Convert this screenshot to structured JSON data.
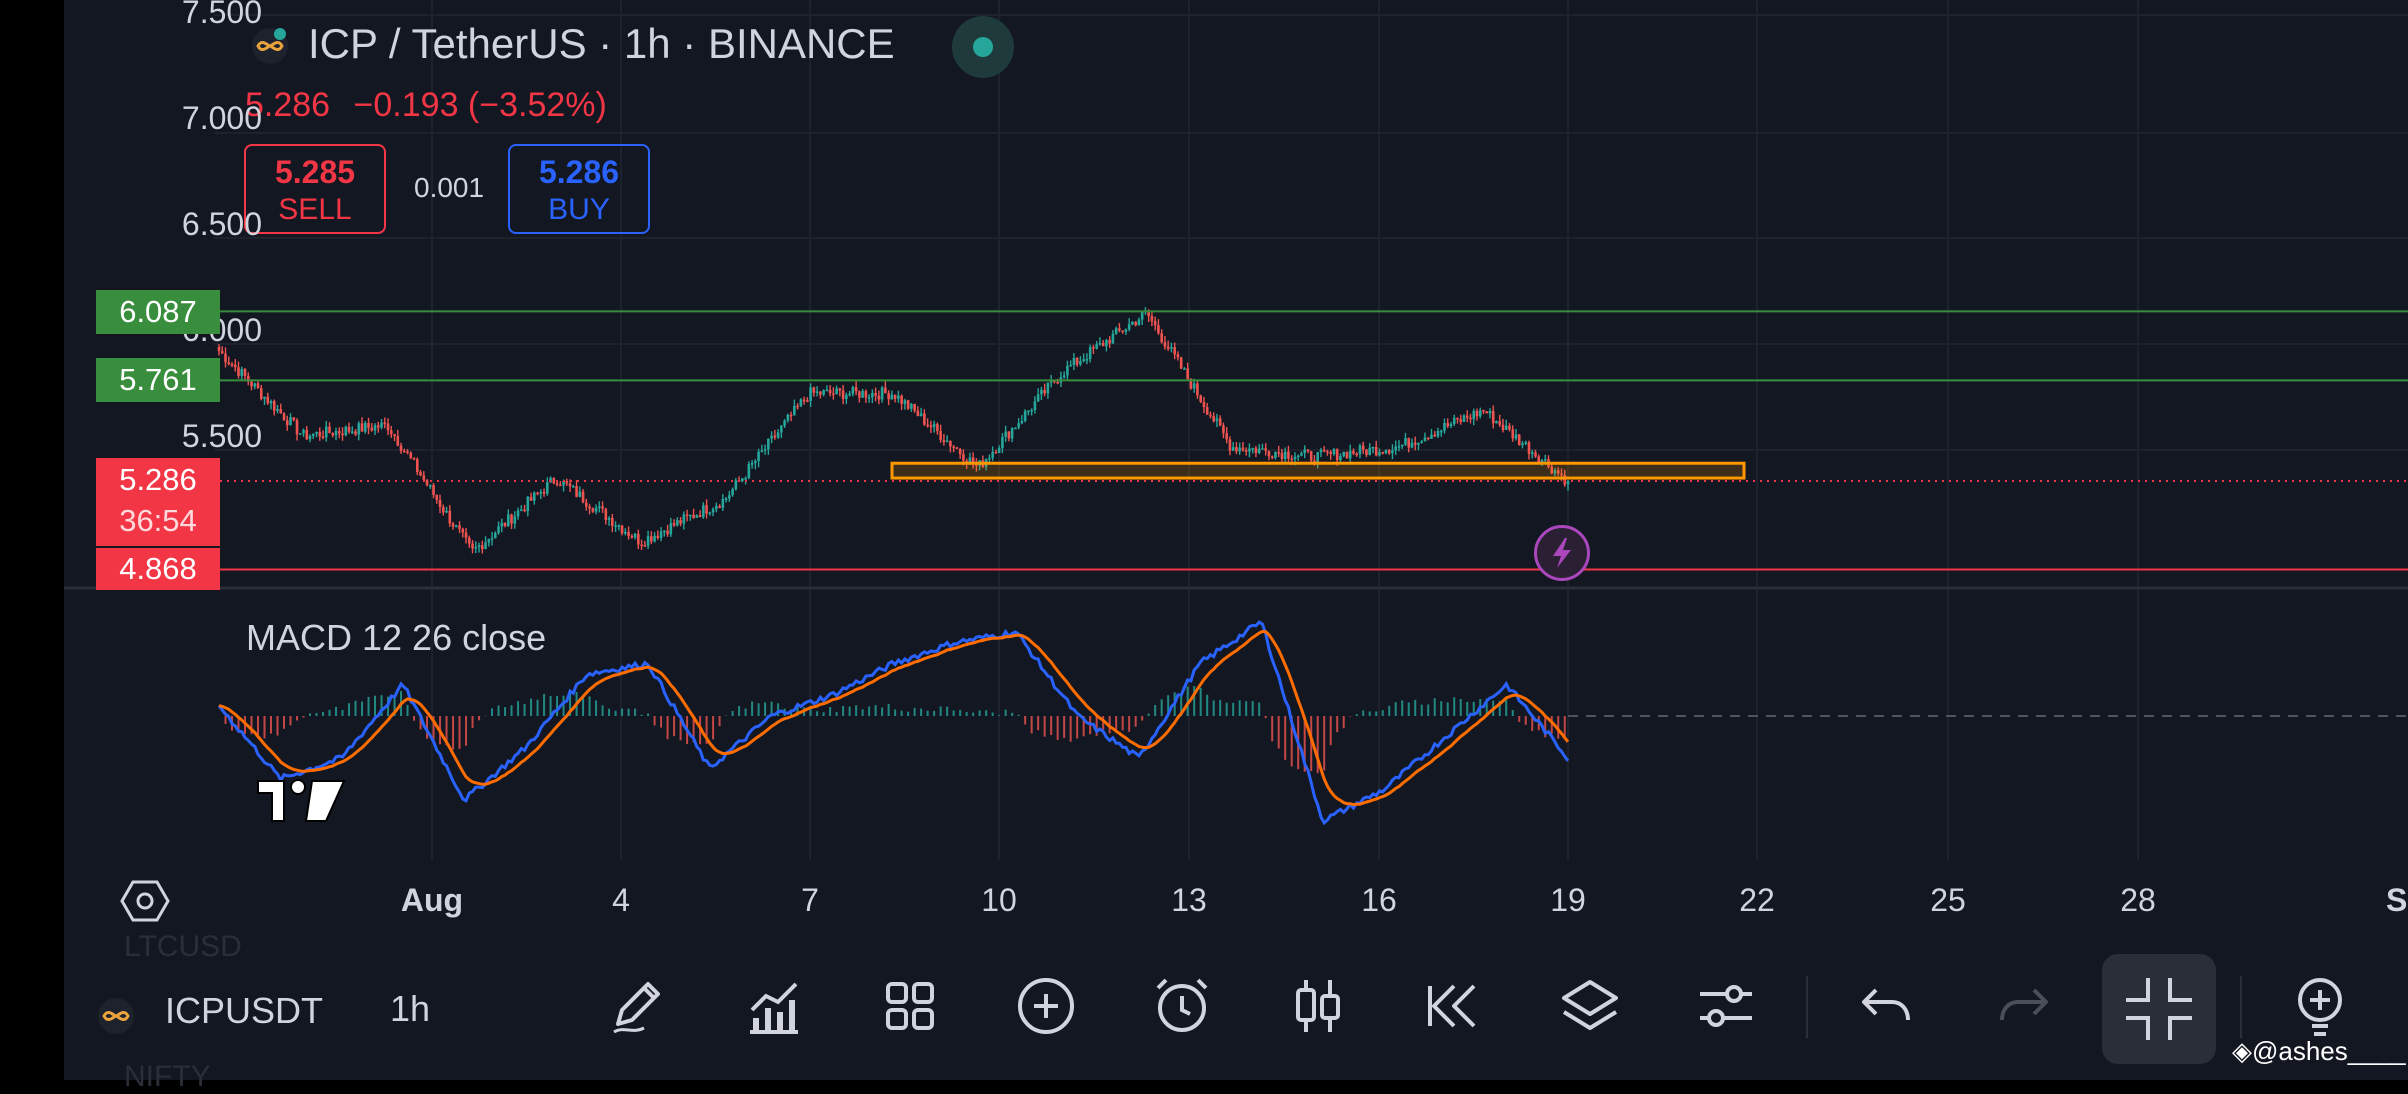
{
  "header": {
    "title": "ICP / TetherUS · 1h · BINANCE",
    "last_price": "5.286",
    "change": "−0.193 (−3.52%)",
    "sell": {
      "price": "5.285",
      "label": "SELL"
    },
    "spread": "0.001",
    "buy": {
      "price": "5.286",
      "label": "BUY"
    }
  },
  "price_axis": {
    "ticks": [
      "7.500",
      "7.000",
      "6.500",
      "6.000",
      "5.500"
    ],
    "tags": {
      "level_high": "6.087",
      "level_mid": "5.761",
      "current_price": "5.286",
      "countdown": "36:54",
      "level_low": "4.868"
    }
  },
  "time_axis": {
    "ticks": [
      "Aug",
      "4",
      "7",
      "10",
      "13",
      "16",
      "19",
      "22",
      "25",
      "28",
      "Sep"
    ]
  },
  "indicator": {
    "label": "MACD 12 26 close"
  },
  "toolbar": {
    "symbol": "ICPUSDT",
    "interval": "1h",
    "ghost_above": "LTCUSD",
    "ghost_below": "NIFTY",
    "icons": [
      "pencil-icon",
      "chart-trend-icon",
      "grid-icon",
      "plus-circle-icon",
      "alarm-clock-icon",
      "candles-icon",
      "rewind-icon",
      "layers-icon",
      "sliders-icon",
      "undo-icon",
      "redo-icon",
      "collapse-icon",
      "idea-bulb-icon"
    ]
  },
  "watermark": "◈@ashes____",
  "colors": {
    "background": "#131722",
    "up": "#26a69a",
    "down": "#ef5350",
    "macd_line": "#2962ff",
    "signal_line": "#ff6d00",
    "price_red": "#f23645",
    "level_green": "#388e3c",
    "rectangle": "#ff9800"
  },
  "chart_data": {
    "type": "candlestick",
    "symbol": "ICPUSDT",
    "interval": "1h",
    "y_range": [
      4.75,
      7.55
    ],
    "horizontal_levels": [
      6.087,
      5.761,
      4.868
    ],
    "current_price": 5.286,
    "approx_close_path": [
      {
        "t": "Jul 31 20:00",
        "close": 5.9
      },
      {
        "t": "Aug 1",
        "close": 5.5
      },
      {
        "t": "Aug 2",
        "close": 5.55
      },
      {
        "t": "Aug 3",
        "close": 4.95
      },
      {
        "t": "Aug 5",
        "close": 5.3
      },
      {
        "t": "Aug 6",
        "close": 5.0
      },
      {
        "t": "Aug 7",
        "close": 5.2
      },
      {
        "t": "Aug 9",
        "close": 5.7
      },
      {
        "t": "Aug 11",
        "close": 5.7
      },
      {
        "t": "Aug 12",
        "close": 5.35
      },
      {
        "t": "Aug 13",
        "close": 5.8
      },
      {
        "t": "Aug 14",
        "close": 6.08
      },
      {
        "t": "Aug 15",
        "close": 5.45
      },
      {
        "t": "Aug 16",
        "close": 5.4
      },
      {
        "t": "Aug 17",
        "close": 5.45
      },
      {
        "t": "Aug 18",
        "close": 5.62
      },
      {
        "t": "Aug 19",
        "close": 5.286
      }
    ],
    "macd": {
      "label": "MACD 12 26 close",
      "approx_path": [
        0.01,
        -0.06,
        -0.04,
        0.03,
        -0.08,
        -0.03,
        0.04,
        0.05,
        -0.05,
        0.0,
        0.02,
        0.05,
        0.07,
        0.08,
        0.0,
        -0.04,
        0.05,
        0.09,
        -0.1,
        -0.07,
        -0.02,
        0.03,
        -0.04
      ]
    }
  }
}
